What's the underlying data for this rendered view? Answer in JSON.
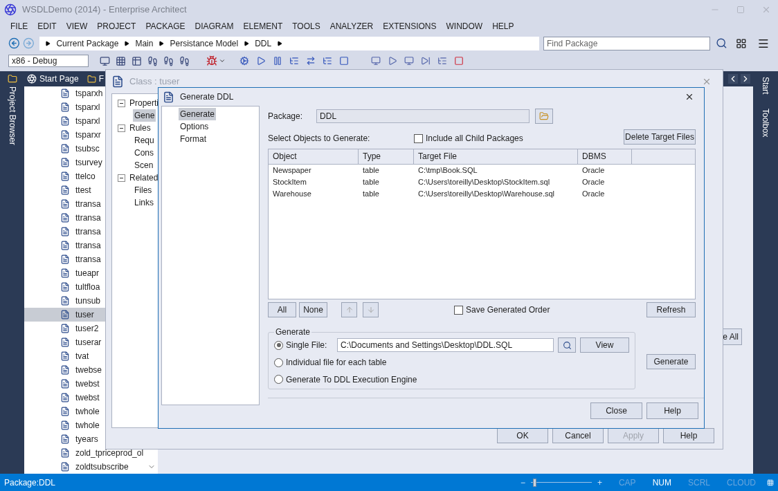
{
  "window": {
    "title": "WSDLDemo (2014) - Enterprise Architect"
  },
  "menu": [
    "FILE",
    "EDIT",
    "VIEW",
    "PROJECT",
    "PACKAGE",
    "DIAGRAM",
    "ELEMENT",
    "TOOLS",
    "ANALYZER",
    "EXTENSIONS",
    "WINDOW",
    "HELP"
  ],
  "breadcrumb": [
    "Current Package",
    "Main",
    "Persistance Model",
    "DDL"
  ],
  "find_package": {
    "placeholder": "Find Package"
  },
  "toolbar": {
    "configuration": "x86 - Debug"
  },
  "left_dock": {
    "label": "Project Browser"
  },
  "right_dock": [
    "Start",
    "Toolbox"
  ],
  "project_browser": {
    "tabs": [
      "Start Page",
      "F"
    ],
    "items": [
      {
        "label": "tsparxh",
        "selected": false
      },
      {
        "label": "tsparxl",
        "selected": false
      },
      {
        "label": "tsparxl",
        "selected": false
      },
      {
        "label": "tsparxr",
        "selected": false
      },
      {
        "label": "tsubsc",
        "selected": false
      },
      {
        "label": "tsurvey",
        "selected": false
      },
      {
        "label": "ttelco",
        "selected": false
      },
      {
        "label": "ttest",
        "selected": false
      },
      {
        "label": "ttransa",
        "selected": false
      },
      {
        "label": "ttransa",
        "selected": false
      },
      {
        "label": "ttransa",
        "selected": false
      },
      {
        "label": "ttransa",
        "selected": false
      },
      {
        "label": "ttransa",
        "selected": false
      },
      {
        "label": "tueapr",
        "selected": false
      },
      {
        "label": "tultfloa",
        "selected": false
      },
      {
        "label": "tunsub",
        "selected": false
      },
      {
        "label": "tuser",
        "selected": true
      },
      {
        "label": "tuser2",
        "selected": false
      },
      {
        "label": "tuserar",
        "selected": false
      },
      {
        "label": "tvat",
        "selected": false
      },
      {
        "label": "twebse",
        "selected": false
      },
      {
        "label": "twebst",
        "selected": false
      },
      {
        "label": "twebst",
        "selected": false
      },
      {
        "label": "twhole",
        "selected": false
      },
      {
        "label": "twhole",
        "selected": false
      },
      {
        "label": "tyears",
        "selected": false
      },
      {
        "label": "zold_tpriceprod_ol",
        "selected": false
      },
      {
        "label": "zoldtsubscribe",
        "selected": false
      }
    ]
  },
  "background_button": "e All",
  "class_dialog": {
    "title": "Class : tuser",
    "tree": [
      {
        "label": "Properti",
        "expanded": true,
        "selected": false,
        "children": [
          {
            "label": "Gene",
            "selected": true
          }
        ]
      },
      {
        "label": "Rules",
        "expanded": true,
        "selected": false,
        "children": [
          {
            "label": "Requ",
            "selected": false
          },
          {
            "label": "Cons",
            "selected": false
          },
          {
            "label": "Scen",
            "selected": false
          }
        ]
      },
      {
        "label": "Related",
        "expanded": true,
        "selected": false,
        "children": [
          {
            "label": "Files",
            "selected": false
          },
          {
            "label": "Links",
            "selected": false
          }
        ]
      }
    ],
    "buttons": [
      {
        "label": "OK",
        "disabled": false
      },
      {
        "label": "Cancel",
        "disabled": false
      },
      {
        "label": "Apply",
        "disabled": true
      },
      {
        "label": "Help",
        "disabled": false
      }
    ]
  },
  "ddl_dialog": {
    "title": "Generate DDL",
    "nav": [
      {
        "label": "Generate",
        "selected": true
      },
      {
        "label": "Options",
        "selected": false
      },
      {
        "label": "Format",
        "selected": false
      }
    ],
    "package": {
      "label": "Package:",
      "value": "DDL"
    },
    "select_label": "Select Objects to Generate:",
    "include_child": {
      "label": "Include all Child Packages",
      "checked": false
    },
    "delete_button": "Delete Target Files",
    "table": {
      "columns": [
        "Object",
        "Type",
        "Target File",
        "DBMS"
      ],
      "rows": [
        [
          "Newspaper",
          "table",
          "C:\\tmp\\Book.SQL",
          "Oracle"
        ],
        [
          "StockItem",
          "table",
          "C:\\Users\\toreilly\\Desktop\\StockItem.sql",
          "Oracle"
        ],
        [
          "Warehouse",
          "table",
          "C:\\Users\\toreilly\\Desktop\\Warehouse.sql",
          "Oracle"
        ]
      ]
    },
    "list_buttons": [
      "All",
      "None"
    ],
    "save_order": {
      "label": "Save Generated Order",
      "checked": false
    },
    "refresh_button": "Refresh",
    "generate_group": {
      "title": "Generate",
      "options": [
        {
          "label": "Single File:",
          "selected": true
        },
        {
          "label": "Individual file for each table",
          "selected": false
        },
        {
          "label": "Generate To DDL Execution Engine",
          "selected": false
        }
      ],
      "file": "C:\\Documents and Settings\\Desktop\\DDL.SQL",
      "view_button": "View"
    },
    "generate_button": "Generate",
    "footer": [
      "Close",
      "Help"
    ]
  },
  "status_bar": {
    "package": "Package:DDL",
    "zoom": {
      "minus": "−",
      "plus": "+",
      "level": 0.04
    },
    "indicators": [
      {
        "label": "CAP",
        "on": false
      },
      {
        "label": "NUM",
        "on": true
      },
      {
        "label": "SCRL",
        "on": false
      },
      {
        "label": "CLOUD",
        "on": false
      }
    ]
  }
}
